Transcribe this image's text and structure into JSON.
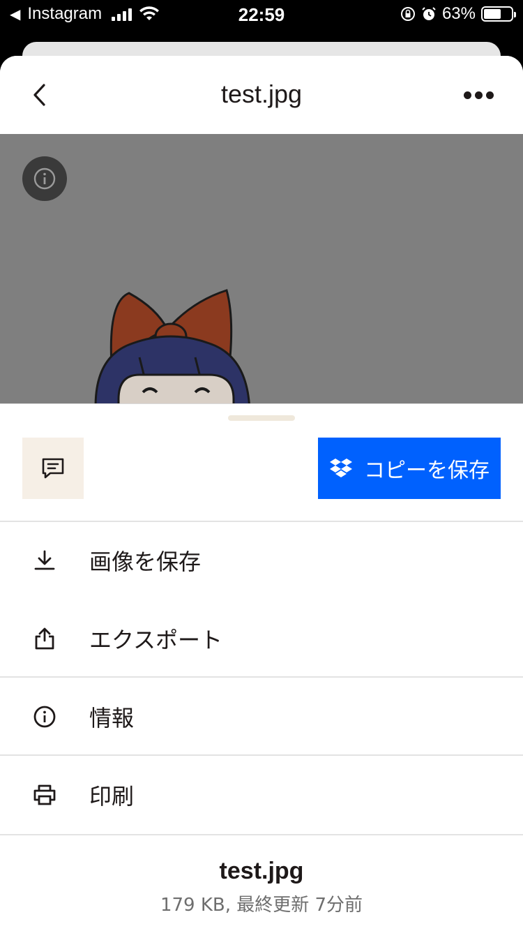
{
  "status_bar": {
    "back_app": "Instagram",
    "time": "22:59",
    "battery_percent": "63%",
    "battery_level": 0.63
  },
  "nav": {
    "title": "test.jpg"
  },
  "actions": {
    "copy_label": "コピーを保存"
  },
  "menu": [
    {
      "label": "画像を保存",
      "icon": "download-icon"
    },
    {
      "label": "エクスポート",
      "icon": "share-icon"
    },
    {
      "label": "情報",
      "icon": "info-icon"
    },
    {
      "label": "印刷",
      "icon": "printer-icon"
    }
  ],
  "file": {
    "name": "test.jpg",
    "meta": "179 KB, 最終更新 7分前"
  },
  "colors": {
    "accent": "#0061fe",
    "comment_bg": "#f6efe6",
    "preview_bg": "#7f7f7f"
  }
}
